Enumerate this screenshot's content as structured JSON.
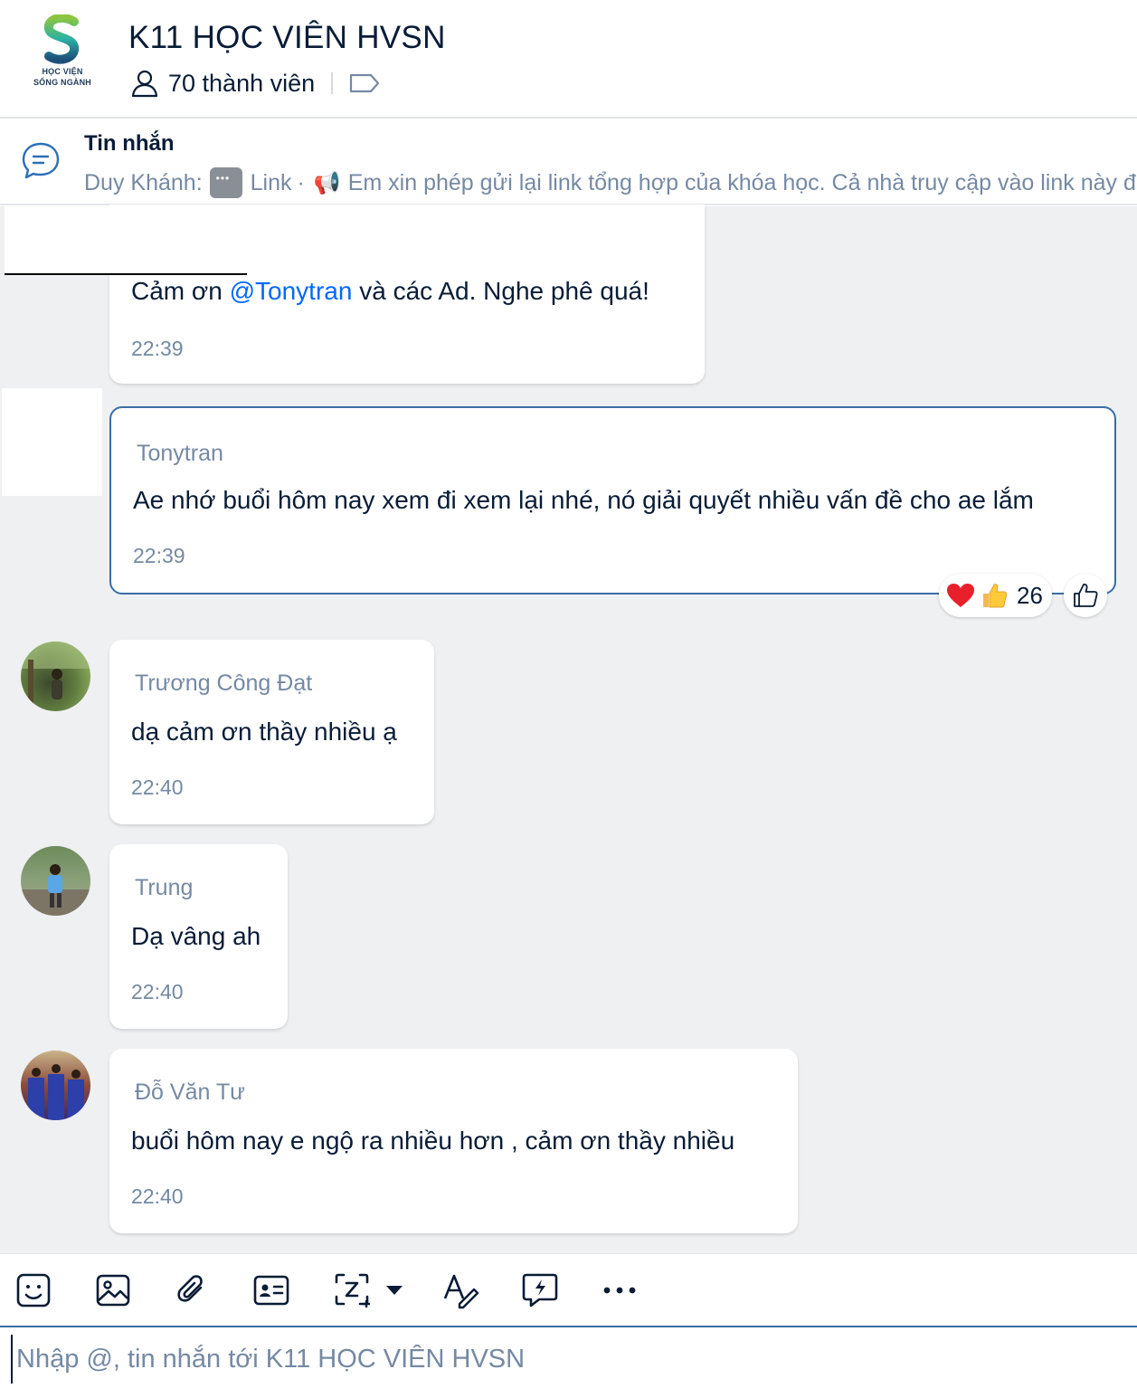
{
  "header": {
    "logo_line1": "HỌC VIỆN",
    "logo_line2": "SỐNG NGÀNH",
    "title": "K11 HỌC VIÊN HVSN",
    "members": "70 thành viên"
  },
  "pinned": {
    "title": "Tin nhắn",
    "sender": "Duy Khánh:",
    "link_label": "Link",
    "dot": "·",
    "preview": "Em xin phép gửi lại link tổng hợp của khóa học. Cả nhà truy cập vào link này để"
  },
  "messages": [
    {
      "sender": "",
      "text_before": "Cảm ơn ",
      "mention": "@Tonytran",
      "text_after": " và các Ad. Nghe phê quá!",
      "time": "22:39"
    },
    {
      "sender": "Tonytran",
      "text": "Ae nhớ buổi hôm nay xem đi xem lại nhé, nó giải quyết nhiều vấn đề cho ae lắm",
      "time": "22:39",
      "reaction_count": "26"
    },
    {
      "sender": "Trương Công Đạt",
      "text": "dạ cảm ơn thầy nhiều ạ",
      "time": "22:40"
    },
    {
      "sender": "Trung",
      "text": "Dạ vâng ah",
      "time": "22:40"
    },
    {
      "sender": "Đỗ Văn Tư",
      "text": "buổi hôm nay e ngộ ra nhiều hơn , cảm ơn thầy nhiều",
      "time": "22:40"
    }
  ],
  "toolbar": {
    "icons": [
      "sticker-icon",
      "image-icon",
      "attachment-icon",
      "contact-card-icon",
      "screenshot-icon",
      "text-format-icon",
      "quick-message-icon",
      "more-icon"
    ]
  },
  "composer": {
    "placeholder": "Nhập @, tin nhắn tới K11 HỌC VIÊN HVSN"
  },
  "colors": {
    "accent": "#0068ff",
    "chat_bg": "#eef0f1",
    "highlight_border": "#3a6ea5"
  }
}
